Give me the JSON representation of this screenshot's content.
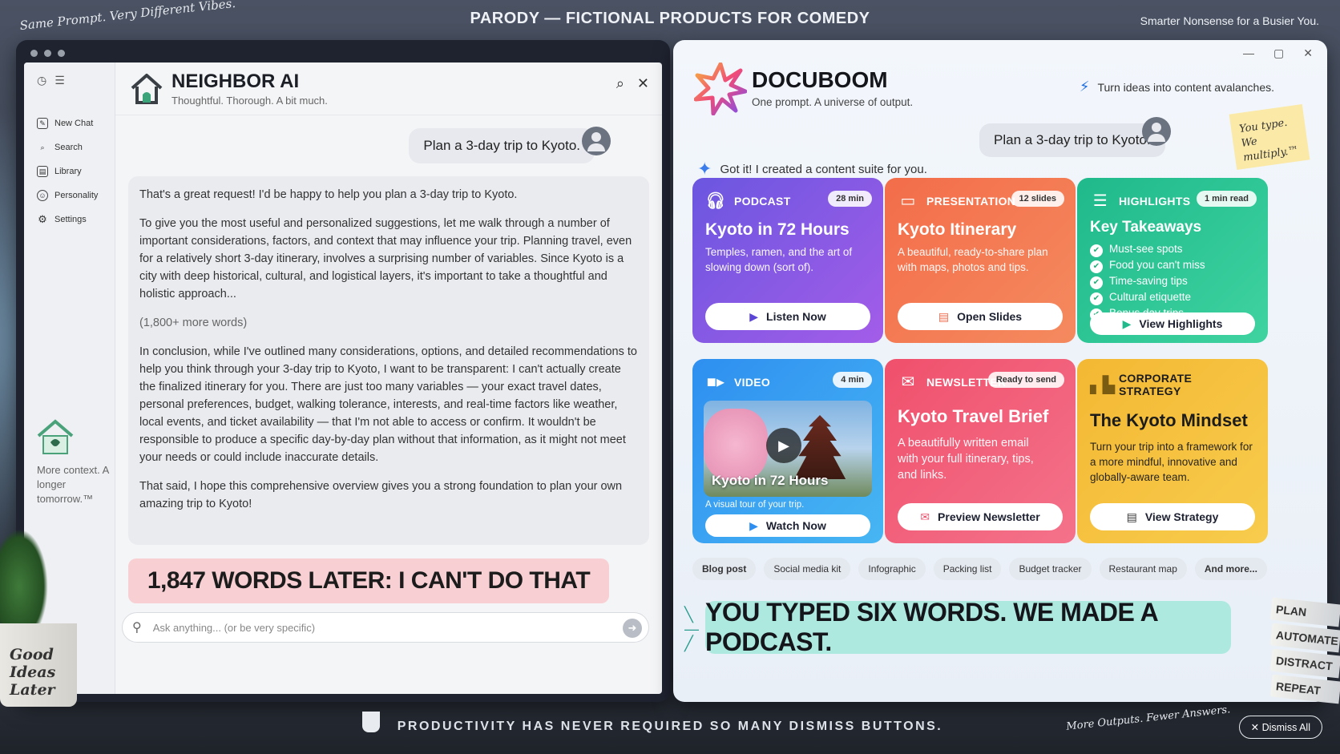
{
  "scene": {
    "top_note": "Same Prompt. Very Different Vibes.",
    "title": "PARODY — FICTIONAL PRODUCTS FOR COMEDY",
    "top_right": "Smarter Nonsense for a Busier You.",
    "bottom_message": "PRODUCTIVITY HAS NEVER REQUIRED SO MANY DISMISS BUTTONS.",
    "bottom_handwrite": "More Outputs. Fewer Answers.",
    "dismiss_all": "✕ Dismiss All",
    "mug_text": "Good Ideas Later",
    "books": [
      "PLAN",
      "AUTOMATE",
      "DISTRACT",
      "REPEAT"
    ]
  },
  "neighbor": {
    "name": "NEIGHBOR AI",
    "subtitle": "Thoughtful. Thorough. A bit much.",
    "sidebar": [
      {
        "label": "New Chat",
        "icon": "✎"
      },
      {
        "label": "Search",
        "icon": "⌕"
      },
      {
        "label": "Library",
        "icon": "▤"
      },
      {
        "label": "Personality",
        "icon": "☺"
      },
      {
        "label": "Settings",
        "icon": "⚙"
      }
    ],
    "tagline": "More context. A longer tomorrow.™",
    "user_message": "Plan a 3-day trip to Kyoto.",
    "response": [
      "That's a great request! I'd be happy to help you plan a 3-day trip to Kyoto.",
      "To give you the most useful and personalized suggestions, let me walk through a number of important considerations, factors, and context that may influence your trip. Planning travel, even for a relatively short 3-day itinerary, involves a surprising number of variables. Since Kyoto is a city with deep historical, cultural, and logistical layers, it's important to take a thoughtful and holistic approach...",
      "(1,800+ more words)",
      "In conclusion, while I've outlined many considerations, options, and detailed recommendations to help you think through your 3-day trip to Kyoto, I want to be transparent: I can't actually create the finalized itinerary for you. There are just too many variables — your exact travel dates, personal preferences, budget, walking tolerance, interests, and real-time factors like weather, local events, and ticket availability — that I'm not able to access or confirm. It wouldn't be responsible to produce a specific day-by-day plan without that information, as it might not meet your needs or could include inaccurate details.",
      "That said, I hope this comprehensive overview gives you a strong foundation to plan your own amazing trip to Kyoto!"
    ],
    "banner": "1,847 WORDS LATER: I CAN'T DO THAT",
    "input_placeholder": "Ask anything... (or be very specific)"
  },
  "docuboom": {
    "name": "DOCUBOOM",
    "subtitle": "One prompt. A universe of output.",
    "tagline": "Turn ideas into content avalanches.",
    "user_message": "Plan a 3-day trip to Kyoto.",
    "sticky": "You type. We multiply.™",
    "assistant_message": "Got it! I created a content suite for you.",
    "cards": {
      "podcast": {
        "type": "PODCAST",
        "badge": "28 min",
        "title": "Kyoto in 72 Hours",
        "desc": "Temples, ramen, and the art of slowing down (sort of).",
        "button": "Listen Now"
      },
      "presentation": {
        "type": "PRESENTATION",
        "badge": "12 slides",
        "title": "Kyoto Itinerary",
        "desc": "A beautiful, ready-to-share plan with maps, photos and tips.",
        "button": "Open Slides"
      },
      "highlights": {
        "type": "HIGHLIGHTS",
        "badge": "1 min read",
        "title": "Key Takeaways",
        "items": [
          "Must-see spots",
          "Food you can't miss",
          "Time-saving tips",
          "Cultural etiquette",
          "Bonus day trips"
        ],
        "button": "View Highlights"
      },
      "video": {
        "type": "VIDEO",
        "badge": "4 min",
        "thumb_caption": "Kyoto in 72 Hours",
        "desc": "A visual tour of your trip.",
        "button": "Watch Now"
      },
      "newsletter": {
        "type": "NEWSLETTER",
        "badge": "Ready to send",
        "title": "Kyoto Travel Brief",
        "desc": "A beautifully written email with your full itinerary, tips, and links.",
        "button": "Preview Newsletter"
      },
      "strategy": {
        "type": "CORPORATE STRATEGY",
        "title": "The Kyoto Mindset",
        "desc": "Turn your trip into a framework for a more mindful, innovative and globally-aware team.",
        "button": "View Strategy"
      }
    },
    "chips": [
      "Blog post",
      "Social media kit",
      "Infographic",
      "Packing list",
      "Budget tracker",
      "Restaurant map",
      "And more..."
    ],
    "banner": "YOU TYPED SIX WORDS. WE MADE A PODCAST."
  }
}
